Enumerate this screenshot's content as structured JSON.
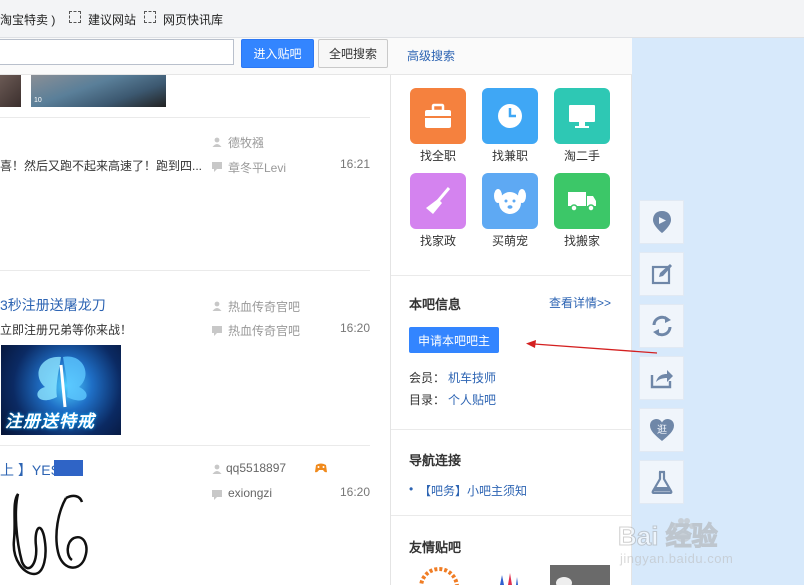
{
  "bookmarks": [
    {
      "label": "淘宝特卖 )"
    },
    {
      "label": "建议网站"
    },
    {
      "label": "网页快讯库"
    }
  ],
  "search": {
    "placeholder": "",
    "enter_label": "进入贴吧",
    "all_label": "全吧搜索",
    "advanced_label": "高级搜索"
  },
  "posts": [
    {
      "abstract": "喜！然后又跑不起来高速了！跑到四...",
      "author": "德牧襁",
      "last_reply": "章冬平Levi",
      "time": "16:21"
    },
    {
      "title": "3秒注册送屠龙刀",
      "abstract": "立即注册兄弟等你来战！",
      "author": "热血传奇官吧",
      "last_reply": "热血传奇官吧",
      "time": "16:20",
      "image_text": "注册送特戒"
    },
    {
      "title": "上 】YES",
      "author": "qq5518897",
      "last_reply": "exiongzi",
      "time": "16:20"
    }
  ],
  "services": [
    {
      "label": "找全职",
      "color": "#f5813e",
      "icon": "briefcase-icon"
    },
    {
      "label": "找兼职",
      "color": "#3fa7f5",
      "icon": "clock-icon"
    },
    {
      "label": "淘二手",
      "color": "#2ec8b4",
      "icon": "monitor-icon"
    },
    {
      "label": "找家政",
      "color": "#d483ef",
      "icon": "broom-icon"
    },
    {
      "label": "买萌宠",
      "color": "#5ea9f3",
      "icon": "dog-icon"
    },
    {
      "label": "找搬家",
      "color": "#3cc768",
      "icon": "truck-icon"
    }
  ],
  "bar_info": {
    "title": "本吧信息",
    "details_link": "查看详情>>",
    "apply_button": "申请本吧吧主",
    "member_label": "会员：",
    "member_value": "机车技师",
    "catalog_label": "目录：",
    "catalog_value": "个人贴吧"
  },
  "nav": {
    "title": "导航连接",
    "items": [
      "【吧务】小吧主须知"
    ]
  },
  "friends": {
    "title": "友情贴吧"
  },
  "tools": [
    "location-icon",
    "edit-icon",
    "refresh-icon",
    "share-icon",
    "heart-icon",
    "flask-icon"
  ],
  "tool_heart_text": "逛",
  "watermark": {
    "text": "Bai 经验",
    "url": "jingyan.baidu.com"
  }
}
